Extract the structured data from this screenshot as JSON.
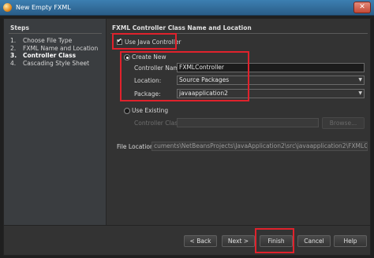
{
  "window": {
    "title": "New Empty FXML",
    "close_glyph": "✕"
  },
  "steps": {
    "heading": "Steps",
    "items": [
      {
        "num": "1.",
        "label": "Choose File Type"
      },
      {
        "num": "2.",
        "label": "FXML Name and Location"
      },
      {
        "num": "3.",
        "label": "Controller Class"
      },
      {
        "num": "4.",
        "label": "Cascading Style Sheet"
      }
    ],
    "current_index": 2
  },
  "panel": {
    "heading": "FXML Controller Class Name and Location",
    "use_java_controller": {
      "label": "Use Java Controller",
      "checked": true
    },
    "create_new": {
      "label": "Create New",
      "selected": true
    },
    "controller_name": {
      "label": "Controller Name:",
      "value": "FXMLController"
    },
    "location": {
      "label": "Location:",
      "value": "Source Packages"
    },
    "package": {
      "label": "Package:",
      "value": "javaapplication2"
    },
    "use_existing": {
      "label": "Use Existing",
      "selected": false
    },
    "controller_class": {
      "label": "Controller Class:",
      "value": ""
    },
    "browse_label": "Browse...",
    "file_location": {
      "label": "File Location:",
      "value": "cuments\\NetBeansProjects\\JavaApplication2\\src\\javaapplication2\\FXMLController.java"
    }
  },
  "footer": {
    "back": "< Back",
    "next": "Next >",
    "finish": "Finish",
    "cancel": "Cancel",
    "help": "Help"
  },
  "colors": {
    "highlight": "#e0222c",
    "titlebar": "#3c7fb1",
    "background": "#333333"
  }
}
